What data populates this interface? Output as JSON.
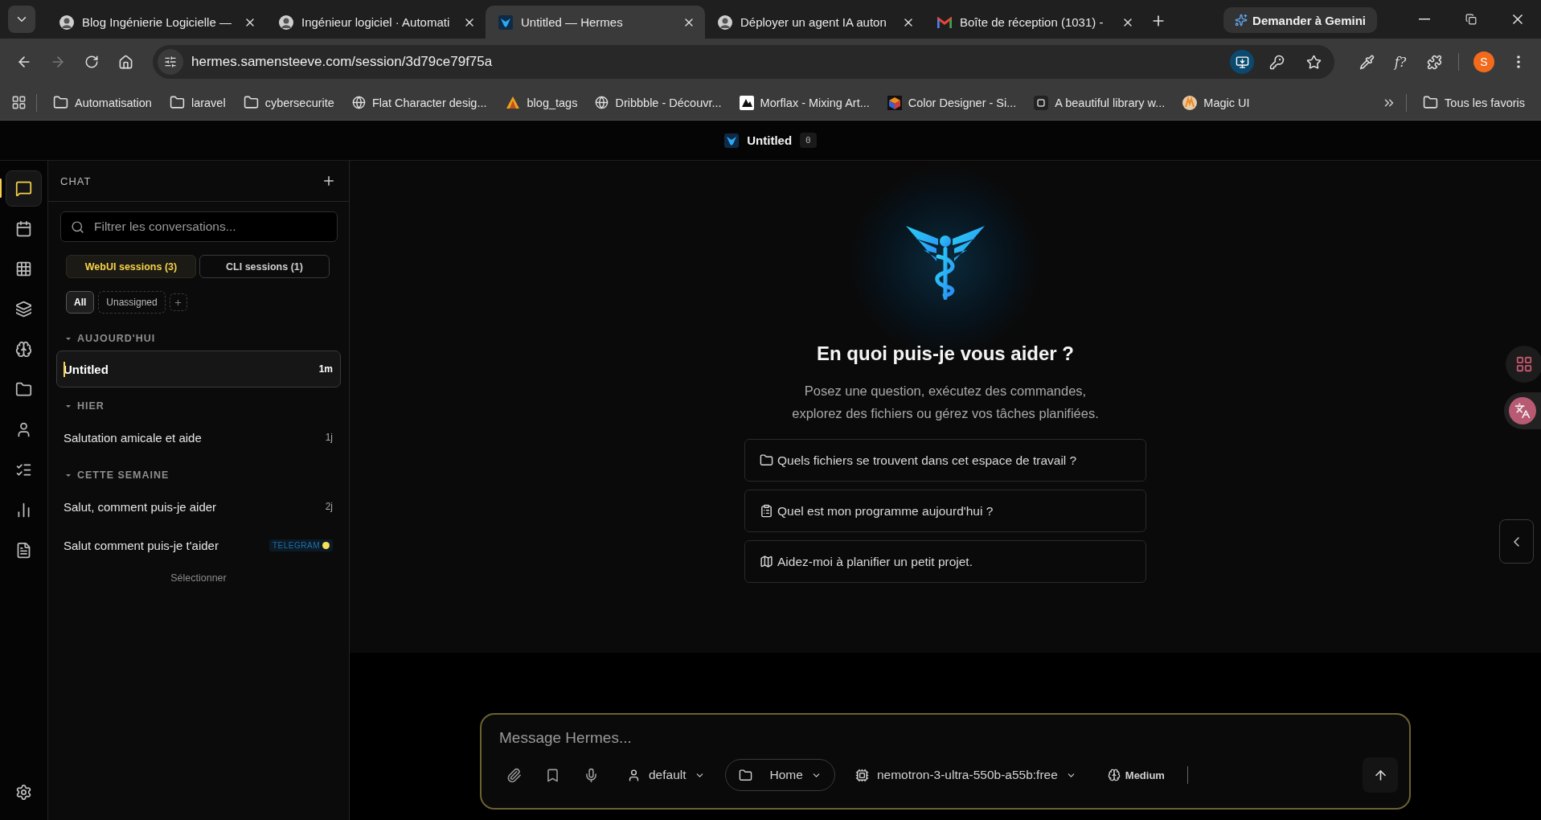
{
  "browser": {
    "tabs": [
      {
        "title": "Blog Ingénierie Logicielle —",
        "kind": "avatar",
        "selected": false
      },
      {
        "title": "Ingénieur logiciel · Automati",
        "kind": "avatar",
        "selected": false
      },
      {
        "title": "Untitled — Hermes",
        "kind": "hermes",
        "selected": true
      },
      {
        "title": "Déployer un agent IA auton",
        "kind": "avatar",
        "selected": false
      },
      {
        "title": "Boîte de réception (1031) -",
        "kind": "mail",
        "selected": false
      }
    ],
    "gemini_button": "Demander à Gemini",
    "url": "hermes.samensteeve.com/session/3d79ce79f75a",
    "extension_label": "f?",
    "profile_initial": "S",
    "bookmarks": [
      {
        "label": "Automatisation",
        "kind": "folder"
      },
      {
        "label": "laravel",
        "kind": "folder"
      },
      {
        "label": "cybersecurite",
        "kind": "folder"
      },
      {
        "label": "Flat Character desig...",
        "kind": "globe"
      },
      {
        "label": "blog_tags",
        "kind": "pma"
      },
      {
        "label": "Dribbble - Découvr...",
        "kind": "globe"
      },
      {
        "label": "Morflax - Mixing Art...",
        "kind": "morflax"
      },
      {
        "label": "Color Designer - Si...",
        "kind": "cube"
      },
      {
        "label": "A beautiful library w...",
        "kind": "dark"
      },
      {
        "label": "Magic UI",
        "kind": "magic"
      }
    ],
    "all_bookmarks": "Tous les favoris"
  },
  "header": {
    "title": "Untitled",
    "count": "0"
  },
  "rail": {
    "items": [
      {
        "selected": true
      },
      {
        "selected": false
      },
      {
        "selected": false
      },
      {
        "selected": false
      },
      {
        "selected": false
      },
      {
        "selected": false
      },
      {
        "selected": false
      },
      {
        "selected": false
      },
      {
        "selected": false
      },
      {
        "selected": false
      }
    ]
  },
  "sidebar": {
    "title": "CHAT",
    "search": {
      "placeholder": "Filtrer les conversations..."
    },
    "session_tabs": [
      {
        "label": "WebUI sessions (3)",
        "selected": true
      },
      {
        "label": "CLI sessions (1)",
        "selected": false
      }
    ],
    "filters": [
      {
        "label": "All",
        "selected": true
      },
      {
        "label": "Unassigned",
        "selected": false
      }
    ],
    "groups": [
      {
        "label": "AUJOURD'HUI",
        "expanded": true,
        "items": [
          {
            "title": "Untitled",
            "time": "1m",
            "selected": true
          }
        ]
      },
      {
        "label": "HIER",
        "expanded": true,
        "items": [
          {
            "title": "Salutation amicale et aide",
            "time": "1j",
            "selected": false
          }
        ]
      },
      {
        "label": "CETTE SEMAINE",
        "expanded": true,
        "items": [
          {
            "title": "Salut, comment puis-je aider",
            "time": "2j",
            "selected": false
          },
          {
            "title": "Salut comment puis-je t'aider",
            "badge": "TELEGRAM",
            "selected": false
          }
        ]
      }
    ],
    "footer": "Sélectionner"
  },
  "empty_state": {
    "heading": "En quoi puis-je vous aider ?",
    "subtitle": [
      "Posez une question, exécutez des commandes,",
      "explorez des fichiers ou gérez vos tâches planifiées."
    ],
    "suggestions": [
      {
        "kind": "folder",
        "text": "Quels fichiers se trouvent dans cet espace de travail ?"
      },
      {
        "kind": "clipboard",
        "text": "Quel est mon programme aujourd'hui ?"
      },
      {
        "kind": "map",
        "text": "Aidez-moi à planifier un petit projet."
      }
    ]
  },
  "composer": {
    "placeholder": "Message Hermes...",
    "profile": "default",
    "workspace": "Home",
    "model": "nemotron-3-ultra-550b-a55b:free",
    "reasoning": "Medium"
  }
}
